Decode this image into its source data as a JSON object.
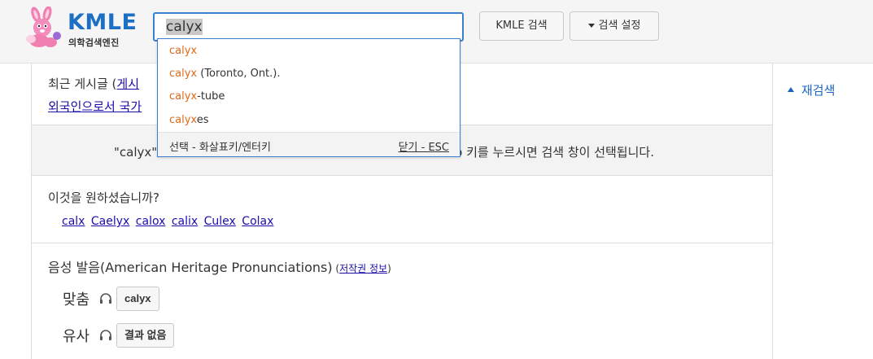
{
  "header": {
    "logo_title": "KMLE",
    "logo_subtitle": "의학검색엔진",
    "search_value": "calyx",
    "search_button": "KMLE 검색",
    "settings_button": "검색 설정"
  },
  "autocomplete": {
    "items": [
      {
        "match": "calyx",
        "rest": ""
      },
      {
        "match": "calyx",
        "rest": " (Toronto, Ont.)."
      },
      {
        "match": "calyx",
        "rest": "-tube"
      },
      {
        "match": "calyx",
        "rest": "es"
      }
    ],
    "footer_hint": "선택 - 화살표키/엔터키",
    "footer_close": "닫기 - ESC"
  },
  "recent": {
    "label_prefix": "최근 게시글 (",
    "label_link": "게시",
    "link2": "외국인으로서 국가"
  },
  "notice": {
    "text_left": "\"calyx\"",
    "text_right": "o 키를 누르시면 검색 창이 선택됩니다."
  },
  "did_you_mean": {
    "question": "이것을 원하셨습니까?",
    "suggestions": [
      "calx",
      "Caelyx",
      "calox",
      "calix",
      "Culex",
      "Colax"
    ]
  },
  "pronunciation": {
    "title": "음성 발음(American Heritage Pronunciations)",
    "copyright_open": " (",
    "copyright_link": "저작권 정보",
    "copyright_close": ")",
    "rows": [
      {
        "label": "맞춤",
        "button": "calyx"
      },
      {
        "label": "유사",
        "button": "결과 없음"
      }
    ]
  },
  "sidebar": {
    "research_label": "재검색"
  }
}
